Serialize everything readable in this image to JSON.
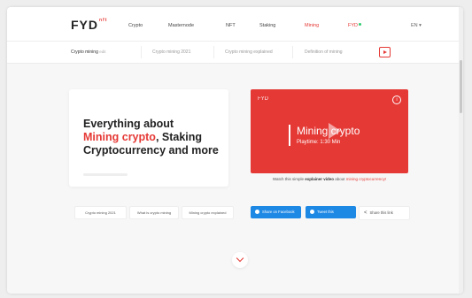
{
  "nav": {
    "logo": "FYD",
    "logo_sup": "nft",
    "items": [
      "Crypto",
      "Masternode",
      "NFT",
      "Staking",
      "Mining",
      "FYD"
    ],
    "lang": "EN ▾"
  },
  "subnav": {
    "first": "Crypto mining",
    "first_suffix": "edit",
    "items": [
      "Crypto mining 2021",
      "Crypto mining explained",
      "Definition of mining"
    ]
  },
  "hero": {
    "line1": "Everything about",
    "line2_red": "Mining crypto",
    "line2_rest": ", Staking",
    "line3": "Cryptocurrency and more"
  },
  "video": {
    "logo": "FYD",
    "info": "i",
    "title": "Mining crypto",
    "subtitle": "Playtime: 1:30 Min",
    "caption_pre": "Watch this simple ",
    "caption_bold": "explainer video",
    "caption_mid": " about ",
    "caption_red": "mining cryptocurrency!"
  },
  "chips": [
    "Crypto mining 2021",
    "What is crypto mining",
    "Mining crypto explained"
  ],
  "share": {
    "facebook": "Share on Facebook",
    "twitter": "Tweet this",
    "link": "Share this link"
  },
  "colors": {
    "accent": "#e53935",
    "share_blue": "#1e88e5"
  }
}
